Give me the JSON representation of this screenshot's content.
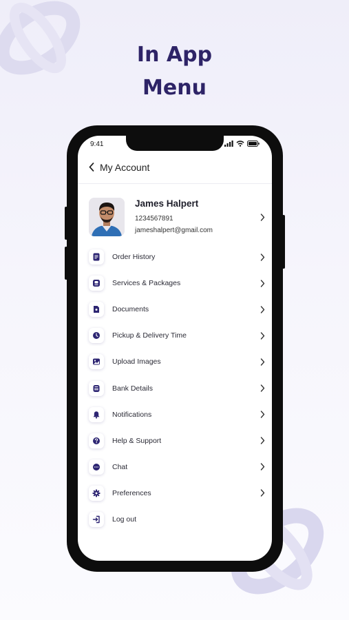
{
  "promo": {
    "title_line1": "In App",
    "title_line2": "Menu"
  },
  "status_bar": {
    "time": "9:41",
    "icons": [
      "cellular-signal-icon",
      "wifi-icon",
      "battery-icon"
    ]
  },
  "header": {
    "title": "My Account",
    "back_icon": "chevron-left-icon"
  },
  "profile": {
    "name": "James Halpert",
    "phone": "1234567891",
    "email": "jameshalpert@gmail.com"
  },
  "menu": {
    "items": [
      {
        "label": "Order History",
        "icon": "order-history-icon",
        "has_chevron": true
      },
      {
        "label": "Services & Packages",
        "icon": "package-icon",
        "has_chevron": true
      },
      {
        "label": "Documents",
        "icon": "document-icon",
        "has_chevron": true
      },
      {
        "label": "Pickup & Delivery Time",
        "icon": "clock-icon",
        "has_chevron": true
      },
      {
        "label": "Upload Images",
        "icon": "image-icon",
        "has_chevron": true
      },
      {
        "label": "Bank Details",
        "icon": "bank-icon",
        "has_chevron": true
      },
      {
        "label": "Notifications",
        "icon": "bell-icon",
        "has_chevron": true
      },
      {
        "label": "Help & Support",
        "icon": "help-icon",
        "has_chevron": true
      },
      {
        "label": "Chat",
        "icon": "chat-icon",
        "has_chevron": true
      },
      {
        "label": "Preferences",
        "icon": "gear-icon",
        "has_chevron": true
      },
      {
        "label": "Log out",
        "icon": "logout-icon",
        "has_chevron": false
      }
    ]
  },
  "colors": {
    "brand": "#2e2467",
    "icon": "#2d2572",
    "decor": "#d9d7ee"
  }
}
